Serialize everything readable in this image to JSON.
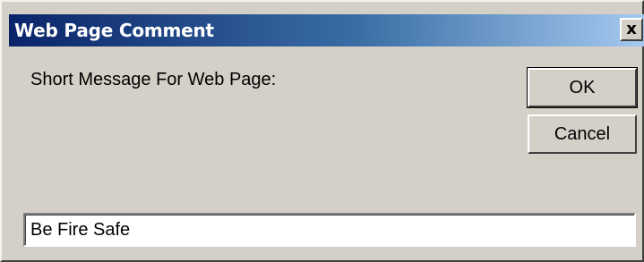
{
  "dialog": {
    "title": "Web Page Comment",
    "close_glyph": "x",
    "message": "Short Message For Web Page:",
    "ok_label": "OK",
    "cancel_label": "Cancel",
    "input_value": "Be Fire Safe"
  },
  "colors": {
    "titlebar_start": "#0a246a",
    "titlebar_end": "#a6caf0",
    "face": "#d4d0c8"
  }
}
